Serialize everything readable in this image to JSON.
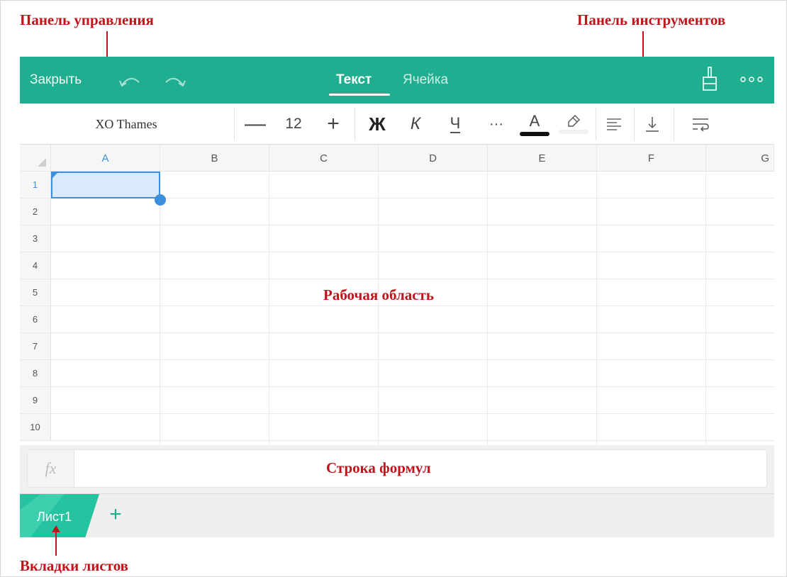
{
  "annotations": {
    "control_panel": "Панель управления",
    "toolbar": "Панель инструментов",
    "work_area": "Рабочая область",
    "formula_bar": "Строка формул",
    "sheet_tabs": "Вкладки листов"
  },
  "control_bar": {
    "close_label": "Закрыть",
    "undo_icon": "undo-icon",
    "redo_icon": "redo-icon",
    "tabs": [
      {
        "label": "Текст",
        "active": true
      },
      {
        "label": "Ячейка",
        "active": false
      }
    ],
    "brush_icon": "format-painter-icon",
    "more_icon": "more-options-icon",
    "accent_color": "#1fae8f"
  },
  "toolbar": {
    "font_name": "XO Thames",
    "font_minus": "—",
    "font_size": "12",
    "font_plus": "+",
    "bold": "Ж",
    "italic": "К",
    "underline": "Ч",
    "more": "···",
    "text_color_letter": "A",
    "text_color": "#111111",
    "highlight_icon": "highlighter-icon",
    "align_icon": "align-left-icon",
    "valign_icon": "align-bottom-icon",
    "wrap_icon": "wrap-text-icon"
  },
  "grid": {
    "columns": [
      "A",
      "B",
      "C",
      "D",
      "E",
      "F",
      "G"
    ],
    "rows": [
      "1",
      "2",
      "3",
      "4",
      "5",
      "6",
      "7",
      "8",
      "9",
      "10"
    ],
    "selected_cell": "A1",
    "selection_color": "#3c8fdc"
  },
  "formula_bar": {
    "fx_label": "fx",
    "value": ""
  },
  "sheets": {
    "tabs": [
      {
        "label": "Лист1",
        "active": true
      }
    ],
    "add_label": "+"
  }
}
